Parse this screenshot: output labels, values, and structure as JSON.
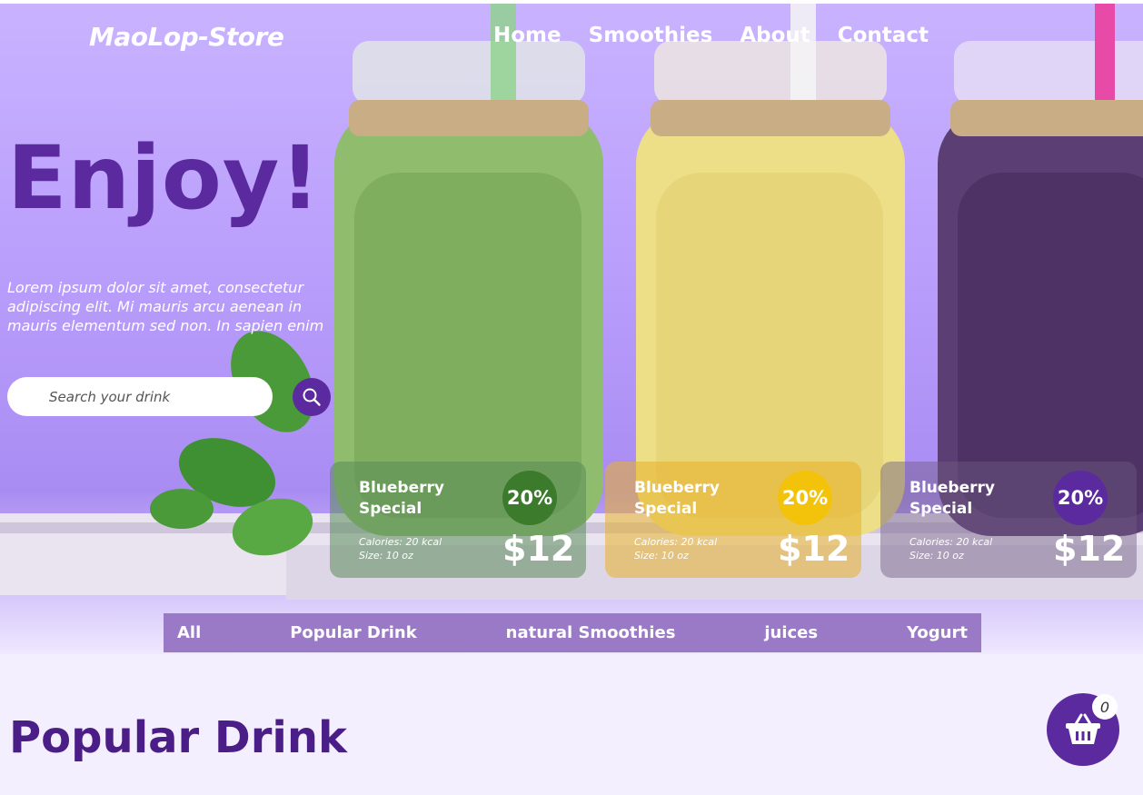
{
  "header": {
    "logo": "MaoLop-Store",
    "nav": [
      "Home",
      "Smoothies",
      "About",
      "Contact"
    ]
  },
  "hero": {
    "headline": "Enjoy!",
    "description": "Lorem ipsum dolor sit amet, consectetur adipiscing elit. Mi mauris arcu aenean in mauris elementum sed non. In sapien enim",
    "search_placeholder": "Search your drink"
  },
  "cards": [
    {
      "name": "Blueberry Special",
      "discount": "20%",
      "calories": "Calories: 20 kcal",
      "size": "Size: 10 oz",
      "price": "$12",
      "accent": "#3c7a2c"
    },
    {
      "name": "Blueberry Special",
      "discount": "20%",
      "calories": "Calories: 20 kcal",
      "size": "Size: 10 oz",
      "price": "$12",
      "accent": "#f2c30a"
    },
    {
      "name": "Blueberry Special",
      "discount": "20%",
      "calories": "Calories: 20 kcal",
      "size": "Size: 10 oz",
      "price": "$12",
      "accent": "#5b2a9e"
    }
  ],
  "tabs": [
    "All",
    "Popular Drink",
    "natural Smoothies",
    "juices",
    "Yogurt"
  ],
  "section_title": "Popular Drink",
  "cart": {
    "count": "0",
    "icon": "basket-icon"
  },
  "colors": {
    "brand": "#5b2a9e",
    "tab_bar": "#9a7ac6"
  }
}
